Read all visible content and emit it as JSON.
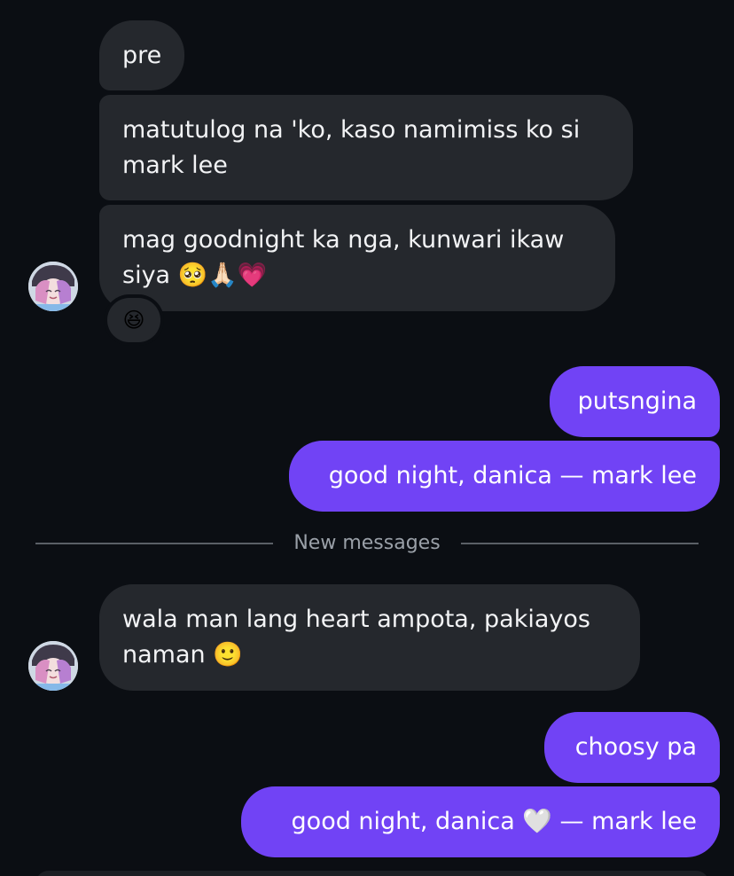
{
  "thread": {
    "incoming": [
      {
        "text": "pre"
      },
      {
        "text": "matutulog na 'ko, kaso namimiss ko si\nmark lee"
      },
      {
        "text": "mag goodnight ka nga, kunwari ikaw\nsiya 🥺🙏🏻💗",
        "reaction": "😆"
      }
    ],
    "outgoing": [
      {
        "text": "putsngina"
      },
      {
        "text": "good night, danica — mark lee"
      }
    ],
    "divider_label": "New messages",
    "incoming_new": [
      {
        "text": "wala man lang heart ampota, pakiayos\nnaman 🙂"
      }
    ],
    "outgoing_new": [
      {
        "text": "choosy pa"
      },
      {
        "text": "good night, danica 🤍 — mark lee"
      }
    ]
  },
  "colors": {
    "background": "#0b0e13",
    "incoming_bubble": "#25282d",
    "outgoing_bubble": "#7143f5",
    "divider": "#5b5f66"
  },
  "icons": {
    "avatar": "user-avatar-anime"
  }
}
